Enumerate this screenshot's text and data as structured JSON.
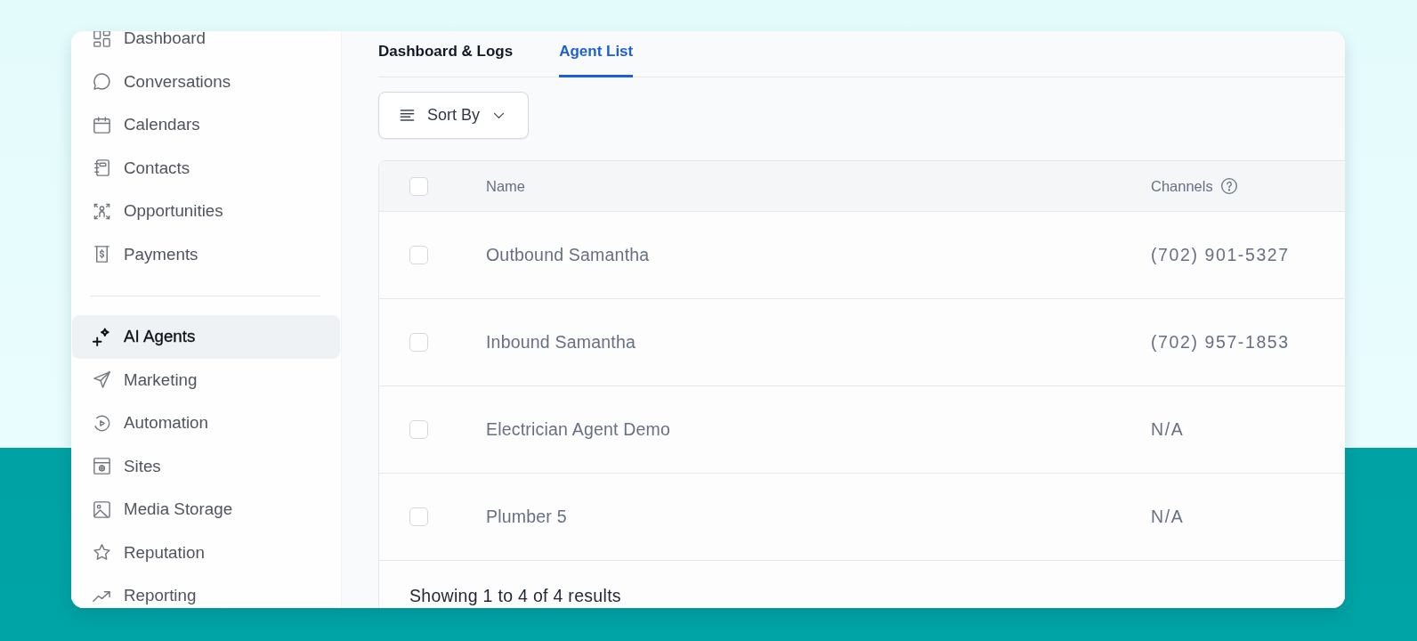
{
  "sidebar": {
    "groups": [
      {
        "items": [
          {
            "label": "Dashboard",
            "selected": false
          },
          {
            "label": "Conversations",
            "selected": false
          },
          {
            "label": "Calendars",
            "selected": false
          },
          {
            "label": "Contacts",
            "selected": false
          },
          {
            "label": "Opportunities",
            "selected": false
          },
          {
            "label": "Payments",
            "selected": false
          }
        ]
      },
      {
        "items": [
          {
            "label": "AI Agents",
            "selected": true
          },
          {
            "label": "Marketing",
            "selected": false
          },
          {
            "label": "Automation",
            "selected": false
          },
          {
            "label": "Sites",
            "selected": false
          },
          {
            "label": "Media Storage",
            "selected": false
          },
          {
            "label": "Reputation",
            "selected": false
          },
          {
            "label": "Reporting",
            "selected": false
          }
        ]
      }
    ]
  },
  "tabs": [
    {
      "label": "Dashboard & Logs",
      "selected": false
    },
    {
      "label": "Agent List",
      "selected": true
    }
  ],
  "sort_button": {
    "label": "Sort By"
  },
  "table": {
    "select_all": {
      "checked": false
    },
    "columns": [
      {
        "label": "Name",
        "help_icon": false
      },
      {
        "label": "Channels",
        "help_icon": true
      }
    ],
    "rows": [
      {
        "checked": false,
        "name": "Outbound Samantha",
        "channels": "(702) 901-5327"
      },
      {
        "checked": false,
        "name": "Inbound Samantha",
        "channels": "(702) 957-1853"
      },
      {
        "checked": false,
        "name": "Electrician Agent Demo",
        "channels": "N/A"
      },
      {
        "checked": false,
        "name": "Plumber 5",
        "channels": "N/A"
      }
    ],
    "footer": "Showing 1 to 4 of 4 results"
  }
}
